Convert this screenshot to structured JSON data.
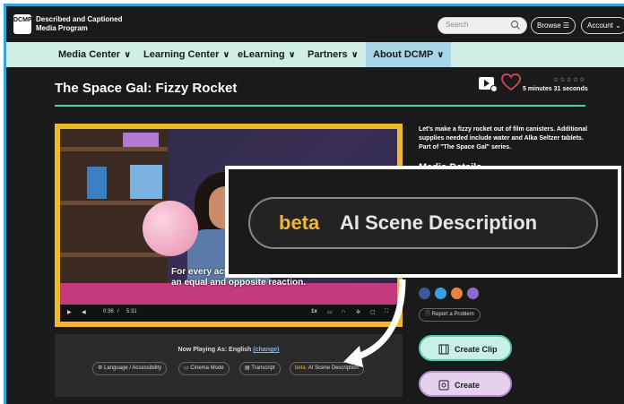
{
  "header": {
    "logo_text": "DCMP",
    "brand": "Described and Captioned Media Program",
    "search_placeholder": "Search",
    "browse_label": "Browse",
    "account_label": "Account"
  },
  "nav": {
    "items": [
      {
        "label": "Media Center"
      },
      {
        "label": "Learning Center"
      },
      {
        "label": "eLearning"
      },
      {
        "label": "Partners"
      },
      {
        "label": "About DCMP"
      }
    ],
    "active_index": 4
  },
  "media": {
    "title": "The Space Gal: Fizzy Rocket",
    "rating_stars": "☆☆☆☆☆",
    "duration": "5 minutes 31 seconds",
    "description": "Let's make a fizzy rocket out of film canisters. Additional supplies needed include water and Alka Seltzer tablets. Part of \"The Space Gal\" series.",
    "details_heading": "Media Details"
  },
  "video": {
    "caption": "For every acti\nan equal and opposite reaction.",
    "current_time": "0:36",
    "separator": "/",
    "total_time": "5:31",
    "speed": "1x"
  },
  "player": {
    "now_playing_prefix": "Now Playing As: English",
    "change_label": "(change)",
    "chips": [
      {
        "label": "Language / Accessibility",
        "icon": "gear-icon"
      },
      {
        "label": "Cinema Mode",
        "icon": "cinema-icon"
      },
      {
        "label": "Transcript",
        "icon": "transcript-icon"
      }
    ],
    "ai_chip": {
      "beta": "beta",
      "label": "AI Scene Description"
    }
  },
  "sidebar": {
    "report_label": "Report a Problem",
    "create_clip_label": "Create Clip",
    "create_lesson_label": "Create Lesson"
  },
  "zoom_callout": {
    "beta": "beta",
    "label": "AI Scene Description"
  },
  "colors": {
    "accent_gold": "#f2b731",
    "nav_bg": "#cfeee6",
    "nav_active": "#a8d6e6",
    "title_rule": "#59c9b0",
    "clip_button": "#c8f0e6",
    "lesson_button": "#e6d2ef",
    "heart": "#d94a5a"
  }
}
